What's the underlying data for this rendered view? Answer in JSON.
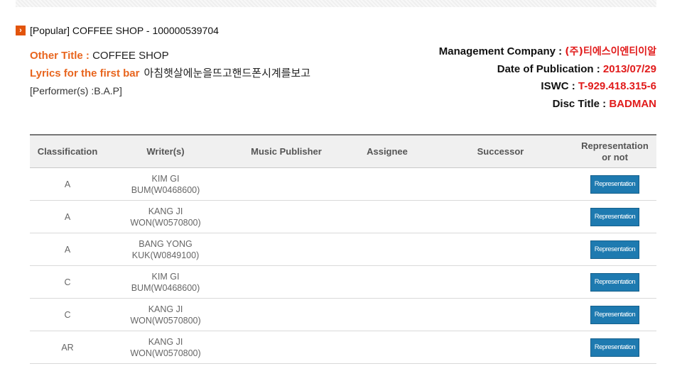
{
  "work": {
    "title_line": "[Popular] COFFEE SHOP - 100000539704"
  },
  "left_info": {
    "other_title_label": "Other Title : ",
    "other_title_value": "COFFEE SHOP",
    "lyrics_label": "Lyrics for the first bar",
    "lyrics_value": "아침햇살에눈을뜨고핸드폰시계를보고",
    "performer": "[Performer(s) :B.A.P]"
  },
  "right_info": {
    "management_label": "Management Company : ",
    "management_value": "(주)티에스이엔티이알",
    "publication_label": "Date of Publication : ",
    "publication_value": "2013/07/29",
    "iswc_label": "ISWC : ",
    "iswc_value": "T-929.418.315-6",
    "disc_label": "Disc Title : ",
    "disc_value": "BADMAN"
  },
  "table": {
    "headers": [
      "Classification",
      "Writer(s)",
      "Music Publisher",
      "Assignee",
      "Successor",
      "Representation or not"
    ],
    "rows": [
      {
        "classification": "A",
        "writer_1": "KIM GI",
        "writer_2": "BUM(W0468600)",
        "publisher": "",
        "assignee": "",
        "successor": "",
        "representation": "Representation"
      },
      {
        "classification": "A",
        "writer_1": "KANG JI",
        "writer_2": "WON(W0570800)",
        "publisher": "",
        "assignee": "",
        "successor": "",
        "representation": "Representation"
      },
      {
        "classification": "A",
        "writer_1": "BANG YONG",
        "writer_2": "KUK(W0849100)",
        "publisher": "",
        "assignee": "",
        "successor": "",
        "representation": "Representation"
      },
      {
        "classification": "C",
        "writer_1": "KIM GI",
        "writer_2": "BUM(W0468600)",
        "publisher": "",
        "assignee": "",
        "successor": "",
        "representation": "Representation"
      },
      {
        "classification": "C",
        "writer_1": "KANG JI",
        "writer_2": "WON(W0570800)",
        "publisher": "",
        "assignee": "",
        "successor": "",
        "representation": "Representation"
      },
      {
        "classification": "AR",
        "writer_1": "KANG JI",
        "writer_2": "WON(W0570800)",
        "publisher": "",
        "assignee": "",
        "successor": "",
        "representation": "Representation"
      }
    ]
  },
  "colors": {
    "accent_orange": "#e8651e",
    "value_red": "#e11b1b",
    "button_blue": "#1e7ab0"
  },
  "icons": {
    "title_marker": "arrow-right-icon"
  }
}
